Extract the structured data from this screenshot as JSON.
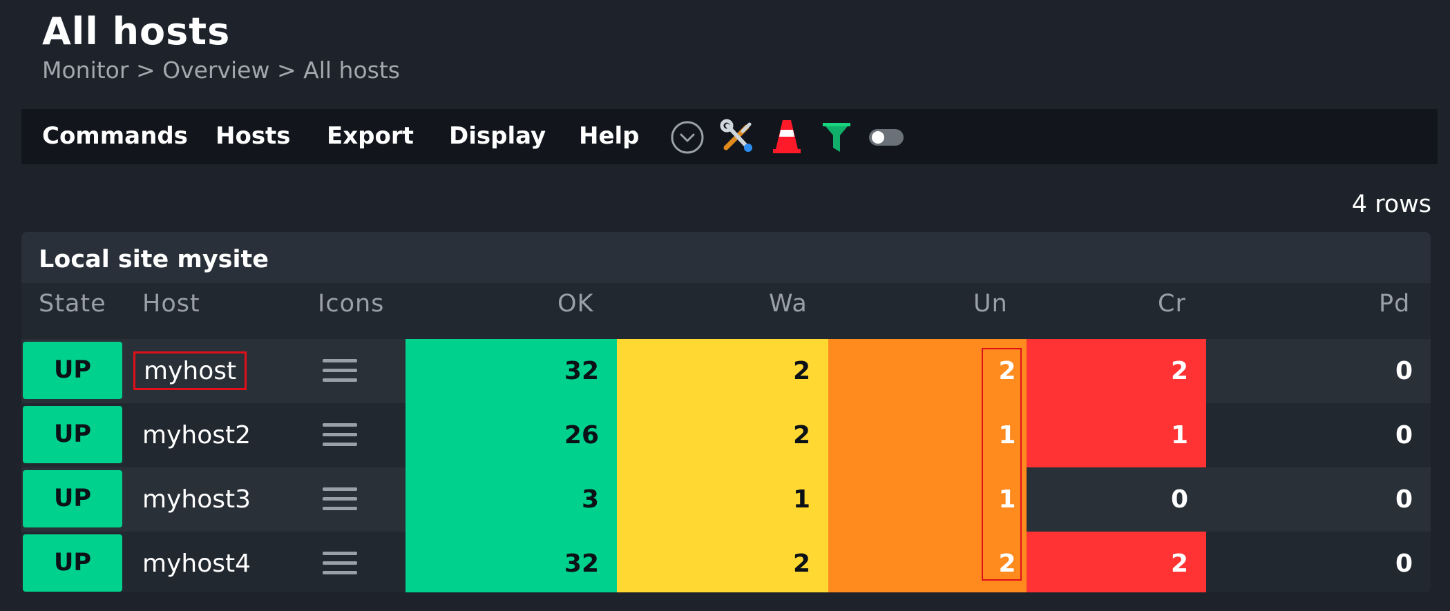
{
  "page": {
    "title": "All hosts",
    "breadcrumb": [
      "Monitor",
      "Overview",
      "All hosts"
    ],
    "breadcrumb_sep": ">"
  },
  "menu": {
    "items": [
      "Commands",
      "Hosts",
      "Export",
      "Display",
      "Help"
    ],
    "icons": [
      "chevron-down-circle-icon",
      "wrench-screwdriver-icon",
      "traffic-cone-icon",
      "filter-funnel-icon",
      "toggle-switch-icon"
    ]
  },
  "rows_count": "4 rows",
  "site": {
    "title": "Local site mysite",
    "columns": [
      "State",
      "Host",
      "Icons",
      "OK",
      "Wa",
      "Un",
      "Cr",
      "Pd"
    ]
  },
  "rows": [
    {
      "state": "UP",
      "host": "myhost",
      "ok": "32",
      "wa": "2",
      "un": "2",
      "cr": "2",
      "pd": "0"
    },
    {
      "state": "UP",
      "host": "myhost2",
      "ok": "26",
      "wa": "2",
      "un": "1",
      "cr": "1",
      "pd": "0"
    },
    {
      "state": "UP",
      "host": "myhost3",
      "ok": "3",
      "wa": "1",
      "un": "1",
      "cr": "0",
      "pd": "0"
    },
    {
      "state": "UP",
      "host": "myhost4",
      "ok": "32",
      "wa": "2",
      "un": "2",
      "cr": "2",
      "pd": "0"
    }
  ],
  "colors": {
    "ok": "#00d18c",
    "warn": "#ffd832",
    "unknown": "#ff8a1e",
    "crit": "#ff3333",
    "highlight": "#e0101a",
    "background": "#1e232b"
  }
}
